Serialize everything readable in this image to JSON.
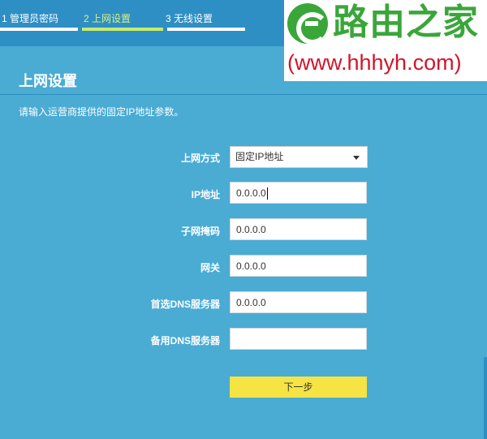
{
  "steps": [
    {
      "label": "1 管理员密码",
      "active": false
    },
    {
      "label": "2 上网设置",
      "active": true
    },
    {
      "label": "3 无线设置",
      "active": false
    }
  ],
  "watermark": {
    "name": "路由之家",
    "url": "(www.hhhyh.com)"
  },
  "page": {
    "title": "上网设置",
    "instruction": "请输入运营商提供的固定IP地址参数。"
  },
  "form": {
    "connection_type": {
      "label": "上网方式",
      "value": "固定IP地址"
    },
    "ip_address": {
      "label": "IP地址",
      "value": "0.0.0.0"
    },
    "subnet_mask": {
      "label": "子网掩码",
      "value": "0.0.0.0"
    },
    "gateway": {
      "label": "网关",
      "value": "0.0.0.0"
    },
    "primary_dns": {
      "label": "首选DNS服务器",
      "value": "0.0.0.0"
    },
    "secondary_dns": {
      "label": "备用DNS服务器",
      "value": ""
    },
    "next_label": "下一步"
  },
  "colors": {
    "background": "#4aabd3",
    "header": "#2d8fc4",
    "active_step": "#c9eb6b",
    "next_button": "#f5e443",
    "watermark_green": "#3aa63a",
    "watermark_red": "#d0162a"
  },
  "icons": {
    "select_arrow": "triangle-down",
    "watermark_logo": "logo-e-circle"
  }
}
